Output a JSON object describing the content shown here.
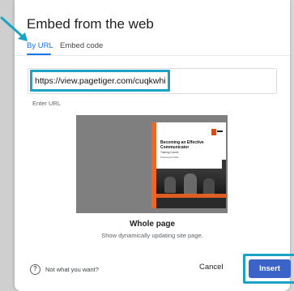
{
  "dialog": {
    "title": "Embed from the web"
  },
  "tabs": [
    {
      "label": "By URL",
      "active": true
    },
    {
      "label": "Embed code",
      "active": false
    }
  ],
  "url_field": {
    "value": "https://view.pagetiger.com/cuqkwhi",
    "label": "Enter URL"
  },
  "preview": {
    "doc_heading": "Becoming an Effective Communicator",
    "doc_subtitle": "Training Course",
    "doc_meta": "Professional Skills",
    "title": "Whole page",
    "description": "Show dynamically updating site page."
  },
  "footer": {
    "help_text": "Not what you want?",
    "cancel_label": "Cancel",
    "insert_label": "Insert"
  },
  "colors": {
    "accent_blue": "#1a73e8",
    "insert_button": "#3c63c8",
    "highlight_outline": "#1aa3c4",
    "doc_orange": "#f26522"
  },
  "icons": {
    "help": "question-circle-icon",
    "pointer": "pointer-arrow-icon"
  }
}
